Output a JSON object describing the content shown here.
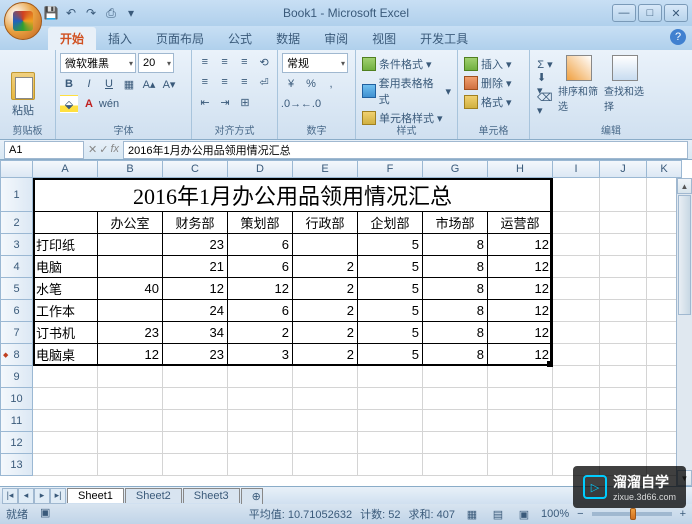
{
  "window": {
    "title": "Book1 - Microsoft Excel"
  },
  "qat": {
    "save": "💾",
    "undo": "↶",
    "redo": "↷",
    "print": "⎙"
  },
  "tabs": {
    "home": "开始",
    "insert": "插入",
    "pagelayout": "页面布局",
    "formulas": "公式",
    "data": "数据",
    "review": "审阅",
    "view": "视图",
    "developer": "开发工具"
  },
  "ribbon": {
    "clipboard": {
      "label": "剪贴板",
      "paste": "粘贴"
    },
    "font": {
      "label": "字体",
      "name": "微软雅黑",
      "size": "20"
    },
    "align": {
      "label": "对齐方式"
    },
    "number": {
      "label": "数字",
      "format": "常规"
    },
    "styles": {
      "label": "样式",
      "cond": "条件格式",
      "tbl": "套用表格格式",
      "cell": "单元格样式"
    },
    "cells": {
      "label": "单元格",
      "insert": "插入",
      "delete": "删除",
      "format": "格式"
    },
    "edit": {
      "label": "编辑",
      "sort": "排序和筛选",
      "find": "查找和选择"
    }
  },
  "namebox": "A1",
  "formula": "2016年1月办公用品领用情况汇总",
  "fx": "fx",
  "table": {
    "title": "2016年1月办公用品领用情况汇总",
    "headers": [
      "",
      "办公室",
      "财务部",
      "策划部",
      "行政部",
      "企划部",
      "市场部",
      "运营部"
    ],
    "rows": [
      [
        "打印纸",
        "",
        "23",
        "6",
        "",
        "5",
        "8",
        "12"
      ],
      [
        "电脑",
        "",
        "21",
        "6",
        "2",
        "5",
        "8",
        "12"
      ],
      [
        "水笔",
        "40",
        "12",
        "12",
        "2",
        "5",
        "8",
        "12"
      ],
      [
        "工作本",
        "",
        "24",
        "6",
        "2",
        "5",
        "8",
        "12"
      ],
      [
        "订书机",
        "23",
        "34",
        "2",
        "2",
        "5",
        "8",
        "12"
      ],
      [
        "电脑桌",
        "12",
        "23",
        "3",
        "2",
        "5",
        "8",
        "12"
      ]
    ]
  },
  "cols": [
    "A",
    "B",
    "C",
    "D",
    "E",
    "F",
    "G",
    "H",
    "I",
    "J",
    "K"
  ],
  "sheets": {
    "s1": "Sheet1",
    "s2": "Sheet2",
    "s3": "Sheet3"
  },
  "status": {
    "ready": "就绪",
    "avg_lbl": "平均值:",
    "avg": "10.71052632",
    "cnt_lbl": "计数:",
    "cnt": "52",
    "sum_lbl": "求和:",
    "sum": "407",
    "zoom": "100%"
  },
  "watermark": {
    "brand": "溜溜自学",
    "site": "zixue.3d66.com"
  }
}
